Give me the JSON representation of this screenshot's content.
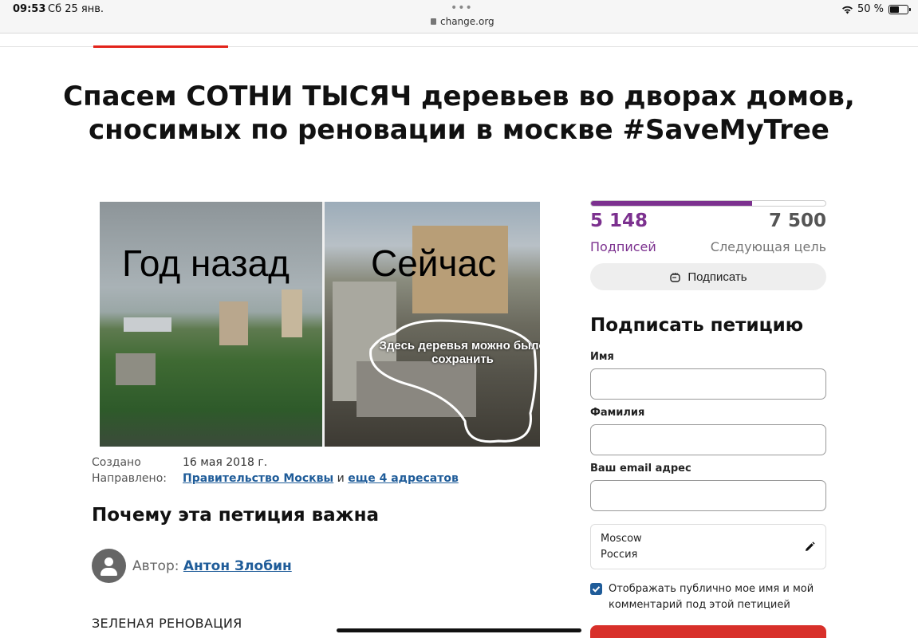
{
  "status_bar": {
    "time": "09:53",
    "date": "Сб 25 янв.",
    "url": "change.org",
    "battery": "50 %",
    "dots": "•••"
  },
  "petition": {
    "title": "Спасем СОТНИ ТЫСЯЧ деревьев во дворах домов, сносимых по реновации в москве #SaveMyTree",
    "image": {
      "caption_left": "Год назад",
      "caption_right": "Сейчас",
      "note": "Здесь деревья можно было сохранить"
    },
    "created_label": "Создано",
    "created_value": "16 мая 2018 г.",
    "directed_label": "Направлено:",
    "directed_primary": "Правительство Москвы",
    "directed_and": "и",
    "directed_more": "еще 4 адресатов",
    "why_title": "Почему эта петиция важна",
    "author_label": "Автор:",
    "author_name": "Антон Злобин",
    "section_heading": "ЗЕЛЕНАЯ РЕНОВАЦИЯ"
  },
  "signatures": {
    "count": "5 148",
    "count_label": "Подписей",
    "goal": "7 500",
    "goal_label": "Следующая цель",
    "progress_fraction": 0.6864,
    "sign_button": "Подписать"
  },
  "form": {
    "title": "Подписать петицию",
    "first_name_label": "Имя",
    "first_name_value": "",
    "last_name_label": "Фамилия",
    "last_name_value": "",
    "email_label": "Ваш email адрес",
    "email_value": "",
    "location_city": "Moscow",
    "location_country": "Россия",
    "public_checkbox_checked": true,
    "public_checkbox_label": "Отображать публично мое имя и мой комментарий под этой петицией"
  },
  "colors": {
    "accent_red": "#e2231a",
    "purple": "#7c318f",
    "link_blue": "#1f5c99",
    "submit_red": "#d8302a"
  },
  "icons": [
    "lock-icon",
    "wifi-icon",
    "battery-icon",
    "fist-icon",
    "pencil-icon",
    "user-avatar-icon",
    "checkmark-icon"
  ]
}
